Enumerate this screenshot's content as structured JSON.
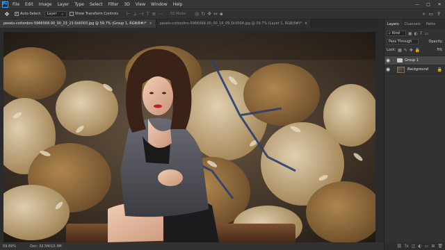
{
  "menu": {
    "items": [
      "File",
      "Edit",
      "Image",
      "Layer",
      "Type",
      "Select",
      "Filter",
      "3D",
      "View",
      "Window",
      "Help"
    ],
    "logo": "Ps"
  },
  "options": {
    "auto_select": "Auto-Select:",
    "auto_select_target": "Layer",
    "show_transform": "Show Transform Controls",
    "mode_3d": "3D Mode:"
  },
  "tabs": [
    {
      "label": "pexels-cottonbro-5966568.00_00_23_23.Still003.jpg @ 59.7% (Group 1, RGB/8#)*",
      "active": true
    },
    {
      "label": "pexels-cottonbro-5966568.00_00_16_09.Still004.jpg @ 59.7% (Layer 1, RGB/8#)*",
      "active": false
    }
  ],
  "status": {
    "zoom": "59.69%",
    "doc": "Doc: 32.5M/15.3M"
  },
  "panel": {
    "tabs": [
      "Layers",
      "Channels",
      "Paths"
    ],
    "kind": "Kind",
    "blend_mode": "Pass Through",
    "opacity_label": "Opacity:",
    "lock_label": "Lock:",
    "fill_label": "Fill:"
  },
  "layers": [
    {
      "name": "Group 1",
      "type": "group",
      "selected": true,
      "italic": false
    },
    {
      "name": "Background",
      "type": "pixel",
      "selected": false,
      "italic": true
    }
  ],
  "icons": {
    "move_tool": "move-icon",
    "eye": "eye-icon",
    "lock": "lock-icon"
  }
}
